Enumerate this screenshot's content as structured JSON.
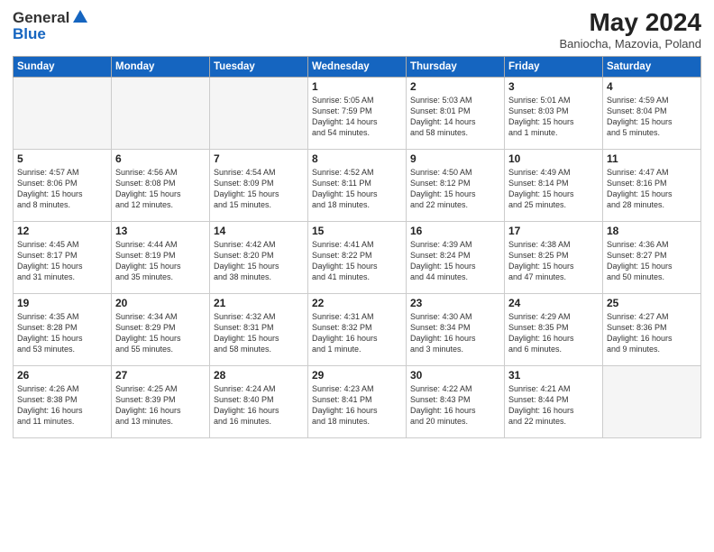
{
  "header": {
    "logo_general": "General",
    "logo_blue": "Blue",
    "month_title": "May 2024",
    "location": "Baniocha, Mazovia, Poland"
  },
  "days_of_week": [
    "Sunday",
    "Monday",
    "Tuesday",
    "Wednesday",
    "Thursday",
    "Friday",
    "Saturday"
  ],
  "weeks": [
    [
      {
        "day": "",
        "info": ""
      },
      {
        "day": "",
        "info": ""
      },
      {
        "day": "",
        "info": ""
      },
      {
        "day": "1",
        "info": "Sunrise: 5:05 AM\nSunset: 7:59 PM\nDaylight: 14 hours\nand 54 minutes."
      },
      {
        "day": "2",
        "info": "Sunrise: 5:03 AM\nSunset: 8:01 PM\nDaylight: 14 hours\nand 58 minutes."
      },
      {
        "day": "3",
        "info": "Sunrise: 5:01 AM\nSunset: 8:03 PM\nDaylight: 15 hours\nand 1 minute."
      },
      {
        "day": "4",
        "info": "Sunrise: 4:59 AM\nSunset: 8:04 PM\nDaylight: 15 hours\nand 5 minutes."
      }
    ],
    [
      {
        "day": "5",
        "info": "Sunrise: 4:57 AM\nSunset: 8:06 PM\nDaylight: 15 hours\nand 8 minutes."
      },
      {
        "day": "6",
        "info": "Sunrise: 4:56 AM\nSunset: 8:08 PM\nDaylight: 15 hours\nand 12 minutes."
      },
      {
        "day": "7",
        "info": "Sunrise: 4:54 AM\nSunset: 8:09 PM\nDaylight: 15 hours\nand 15 minutes."
      },
      {
        "day": "8",
        "info": "Sunrise: 4:52 AM\nSunset: 8:11 PM\nDaylight: 15 hours\nand 18 minutes."
      },
      {
        "day": "9",
        "info": "Sunrise: 4:50 AM\nSunset: 8:12 PM\nDaylight: 15 hours\nand 22 minutes."
      },
      {
        "day": "10",
        "info": "Sunrise: 4:49 AM\nSunset: 8:14 PM\nDaylight: 15 hours\nand 25 minutes."
      },
      {
        "day": "11",
        "info": "Sunrise: 4:47 AM\nSunset: 8:16 PM\nDaylight: 15 hours\nand 28 minutes."
      }
    ],
    [
      {
        "day": "12",
        "info": "Sunrise: 4:45 AM\nSunset: 8:17 PM\nDaylight: 15 hours\nand 31 minutes."
      },
      {
        "day": "13",
        "info": "Sunrise: 4:44 AM\nSunset: 8:19 PM\nDaylight: 15 hours\nand 35 minutes."
      },
      {
        "day": "14",
        "info": "Sunrise: 4:42 AM\nSunset: 8:20 PM\nDaylight: 15 hours\nand 38 minutes."
      },
      {
        "day": "15",
        "info": "Sunrise: 4:41 AM\nSunset: 8:22 PM\nDaylight: 15 hours\nand 41 minutes."
      },
      {
        "day": "16",
        "info": "Sunrise: 4:39 AM\nSunset: 8:24 PM\nDaylight: 15 hours\nand 44 minutes."
      },
      {
        "day": "17",
        "info": "Sunrise: 4:38 AM\nSunset: 8:25 PM\nDaylight: 15 hours\nand 47 minutes."
      },
      {
        "day": "18",
        "info": "Sunrise: 4:36 AM\nSunset: 8:27 PM\nDaylight: 15 hours\nand 50 minutes."
      }
    ],
    [
      {
        "day": "19",
        "info": "Sunrise: 4:35 AM\nSunset: 8:28 PM\nDaylight: 15 hours\nand 53 minutes."
      },
      {
        "day": "20",
        "info": "Sunrise: 4:34 AM\nSunset: 8:29 PM\nDaylight: 15 hours\nand 55 minutes."
      },
      {
        "day": "21",
        "info": "Sunrise: 4:32 AM\nSunset: 8:31 PM\nDaylight: 15 hours\nand 58 minutes."
      },
      {
        "day": "22",
        "info": "Sunrise: 4:31 AM\nSunset: 8:32 PM\nDaylight: 16 hours\nand 1 minute."
      },
      {
        "day": "23",
        "info": "Sunrise: 4:30 AM\nSunset: 8:34 PM\nDaylight: 16 hours\nand 3 minutes."
      },
      {
        "day": "24",
        "info": "Sunrise: 4:29 AM\nSunset: 8:35 PM\nDaylight: 16 hours\nand 6 minutes."
      },
      {
        "day": "25",
        "info": "Sunrise: 4:27 AM\nSunset: 8:36 PM\nDaylight: 16 hours\nand 9 minutes."
      }
    ],
    [
      {
        "day": "26",
        "info": "Sunrise: 4:26 AM\nSunset: 8:38 PM\nDaylight: 16 hours\nand 11 minutes."
      },
      {
        "day": "27",
        "info": "Sunrise: 4:25 AM\nSunset: 8:39 PM\nDaylight: 16 hours\nand 13 minutes."
      },
      {
        "day": "28",
        "info": "Sunrise: 4:24 AM\nSunset: 8:40 PM\nDaylight: 16 hours\nand 16 minutes."
      },
      {
        "day": "29",
        "info": "Sunrise: 4:23 AM\nSunset: 8:41 PM\nDaylight: 16 hours\nand 18 minutes."
      },
      {
        "day": "30",
        "info": "Sunrise: 4:22 AM\nSunset: 8:43 PM\nDaylight: 16 hours\nand 20 minutes."
      },
      {
        "day": "31",
        "info": "Sunrise: 4:21 AM\nSunset: 8:44 PM\nDaylight: 16 hours\nand 22 minutes."
      },
      {
        "day": "",
        "info": ""
      }
    ]
  ]
}
